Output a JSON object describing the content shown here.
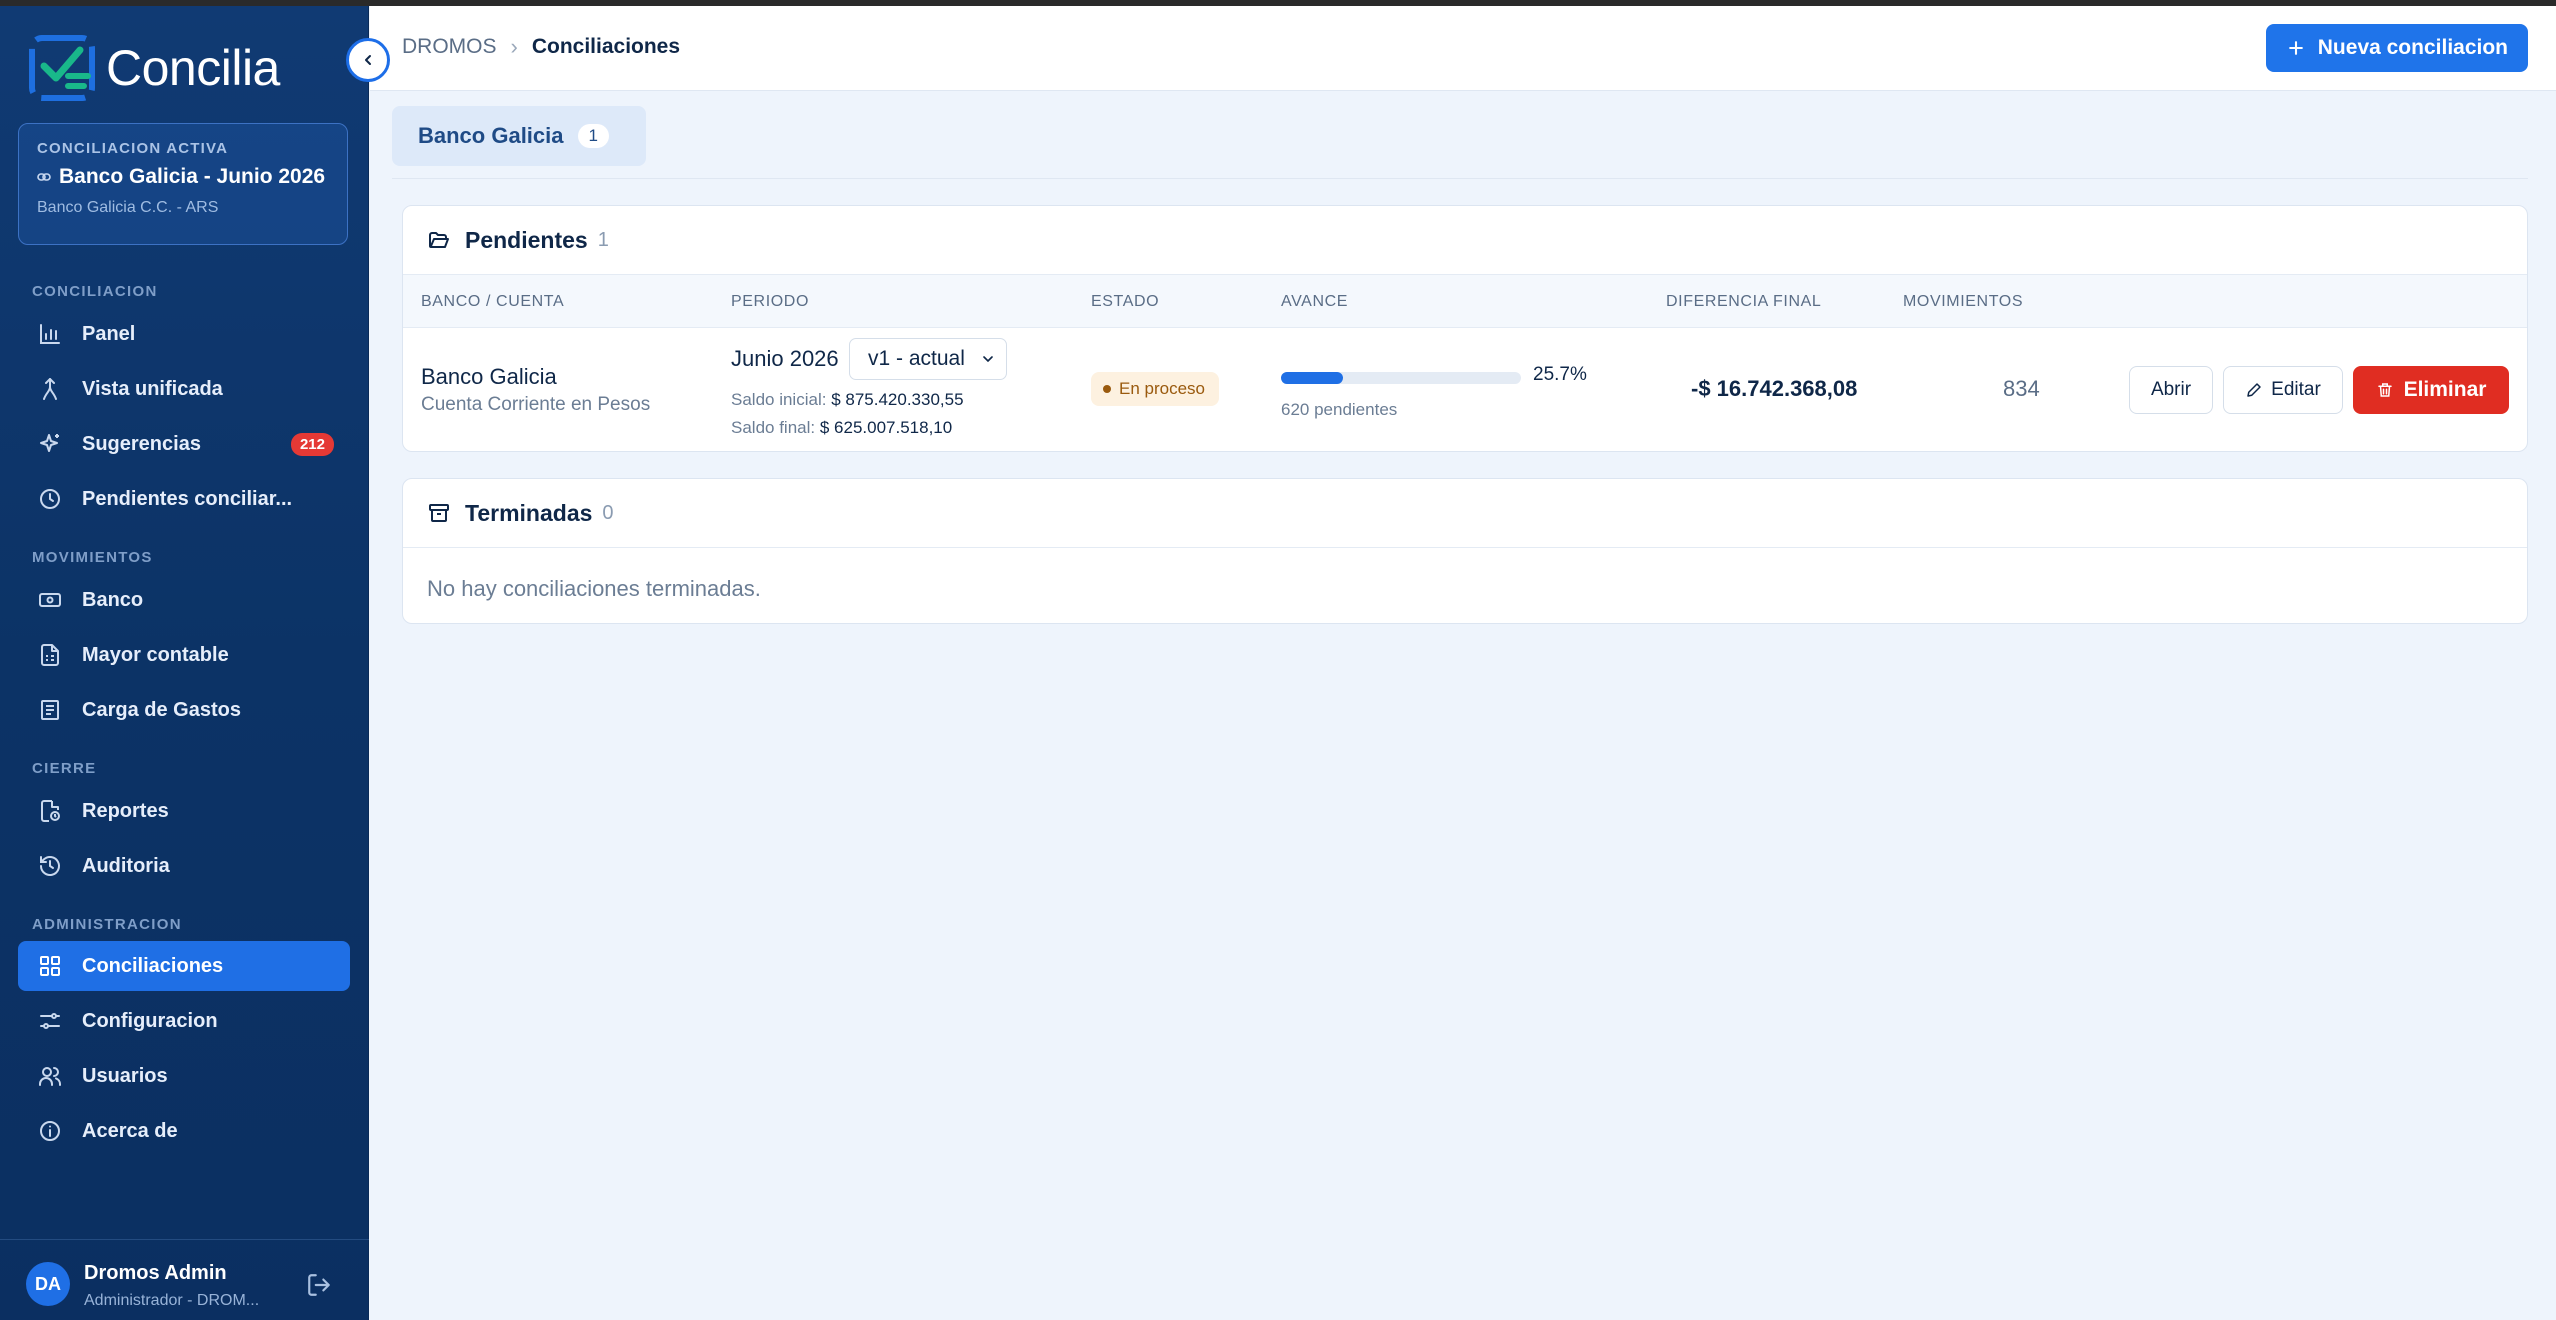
{
  "app": {
    "name": "Concilia"
  },
  "active_reconciliation": {
    "label": "CONCILIACION ACTIVA",
    "title": "Banco Galicia - Junio 2026",
    "subtitle": "Banco Galicia C.C. - ARS"
  },
  "sidebar": {
    "sections": [
      {
        "label": "CONCILIACION"
      },
      {
        "label": "MOVIMIENTOS"
      },
      {
        "label": "CIERRE"
      },
      {
        "label": "ADMINISTRACION"
      }
    ],
    "items": [
      {
        "label": "Panel",
        "icon": "bar-chart-icon"
      },
      {
        "label": "Vista unificada",
        "icon": "merge-icon"
      },
      {
        "label": "Sugerencias",
        "icon": "sparkles-icon",
        "badge": "212"
      },
      {
        "label": "Pendientes conciliar...",
        "icon": "clock-icon"
      },
      {
        "label": "Banco",
        "icon": "banknote-icon"
      },
      {
        "label": "Mayor contable",
        "icon": "ledger-icon"
      },
      {
        "label": "Carga de Gastos",
        "icon": "receipt-icon"
      },
      {
        "label": "Reportes",
        "icon": "report-icon"
      },
      {
        "label": "Auditoria",
        "icon": "history-icon"
      },
      {
        "label": "Conciliaciones",
        "icon": "grid-icon",
        "active": true
      },
      {
        "label": "Configuracion",
        "icon": "sliders-icon"
      },
      {
        "label": "Usuarios",
        "icon": "users-icon"
      },
      {
        "label": "Acerca de",
        "icon": "info-icon"
      }
    ]
  },
  "user": {
    "initials": "DA",
    "name": "Dromos Admin",
    "role": "Administrador - DROM..."
  },
  "header": {
    "breadcrumb": [
      "DROMOS",
      "Conciliaciones"
    ],
    "new_button": "Nueva conciliacion"
  },
  "tabs": [
    {
      "label": "Banco Galicia",
      "count": "1"
    }
  ],
  "pending": {
    "title": "Pendientes",
    "count": "1",
    "columns": [
      "BANCO / CUENTA",
      "PERIODO",
      "ESTADO",
      "AVANCE",
      "DIFERENCIA FINAL",
      "MOVIMIENTOS"
    ],
    "rows": [
      {
        "bank": "Banco Galicia",
        "account": "Cuenta Corriente en Pesos",
        "period": "Junio 2026",
        "version": "v1 - actual",
        "saldo_inicial_label": "Saldo inicial:",
        "saldo_inicial": "$ 875.420.330,55",
        "saldo_final_label": "Saldo final:",
        "saldo_final": "$ 625.007.518,10",
        "status": "En proceso",
        "progress": 25.7,
        "progress_label": "25.7%",
        "pending_label": "620 pendientes",
        "difference": "-$ 16.742.368,08",
        "movements": "834",
        "actions": {
          "open": "Abrir",
          "edit": "Editar",
          "delete": "Eliminar"
        }
      }
    ]
  },
  "finished": {
    "title": "Terminadas",
    "count": "0",
    "empty": "No hay conciliaciones terminadas."
  },
  "colors": {
    "primary": "#1f74ea",
    "sidebar": "#0c3366",
    "danger": "#e02d22",
    "status_bg": "#fdf1e0"
  }
}
